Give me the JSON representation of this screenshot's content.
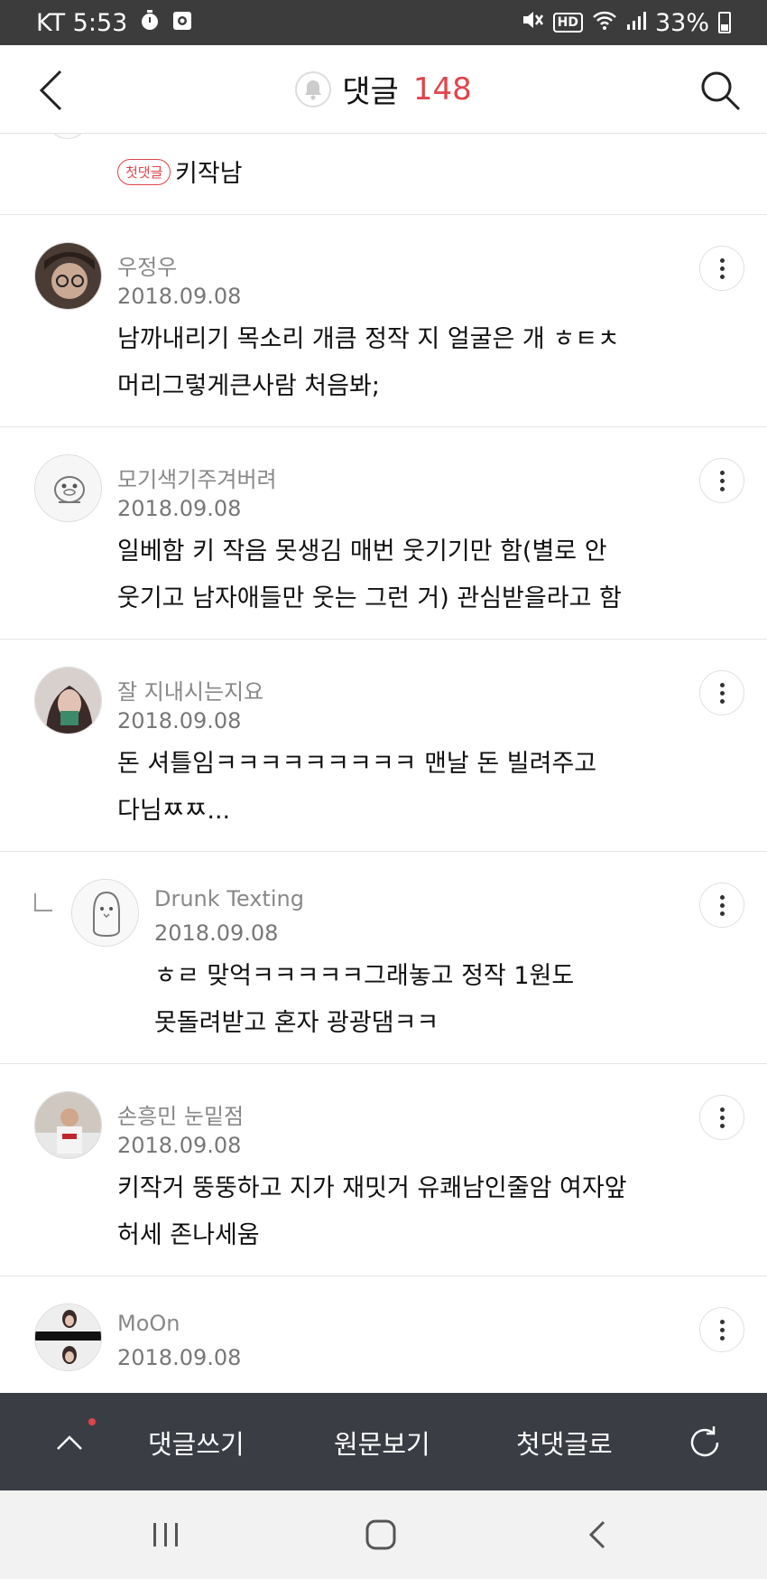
{
  "status_bar": {
    "carrier_time": "KT 5:53",
    "network_badge": "HD",
    "battery": "33%"
  },
  "header": {
    "title": "댓글",
    "count": "148",
    "back_icon": "chevron-left-icon",
    "search_icon": "search-icon",
    "bell_icon": "bell-icon"
  },
  "first_comment": {
    "badge": "첫댓글",
    "text": "키작남"
  },
  "comments": [
    {
      "name": "우정우",
      "date": "2018.09.08",
      "lines": [
        "남까내리기 목소리 개큼 정작 지 얼굴은 개 ㅎㅌㅊ",
        "머리그렇게큰사람 처음봐;"
      ],
      "reply": false
    },
    {
      "name": "모기색기주겨버려",
      "date": "2018.09.08",
      "lines": [
        "일베함 키 작음 못생김 매번 웃기기만 함(별로 안",
        "웃기고 남자애들만 웃는 그런 거) 관심받을라고 함"
      ],
      "reply": false
    },
    {
      "name": "잘 지내시는지요",
      "date": "2018.09.08",
      "lines": [
        "돈 셔틀임ㅋㅋㅋㅋㅋㅋㅋㅋㅋ 맨날 돈 빌려주고",
        "다님ㅉㅉ..."
      ],
      "reply": false
    },
    {
      "name": "Drunk Texting",
      "date": "2018.09.08",
      "lines": [
        "ㅎㄹ 맞억ㅋㅋㅋㅋㅋ그래놓고 정작 1원도",
        "못돌려받고 혼자 광광댐ㅋㅋ"
      ],
      "reply": true
    },
    {
      "name": "손흥민 눈밑점",
      "date": "2018.09.08",
      "lines": [
        "키작거 뚱뚱하고 지가 재밋거 유쾌남인줄암 여자앞",
        "허세 존나세움"
      ],
      "reply": false
    },
    {
      "name": "MoOn",
      "date": "2018.09.08",
      "lines": [
        "",
        ""
      ],
      "reply": false
    }
  ],
  "action_bar": {
    "write": "댓글쓰기",
    "original": "원문보기",
    "first": "첫댓글로",
    "up_icon": "chevron-up-icon",
    "refresh_icon": "refresh-icon"
  },
  "nav_bar": {
    "recent_icon": "recent-apps-icon",
    "home_icon": "home-icon",
    "back_icon": "back-icon"
  }
}
